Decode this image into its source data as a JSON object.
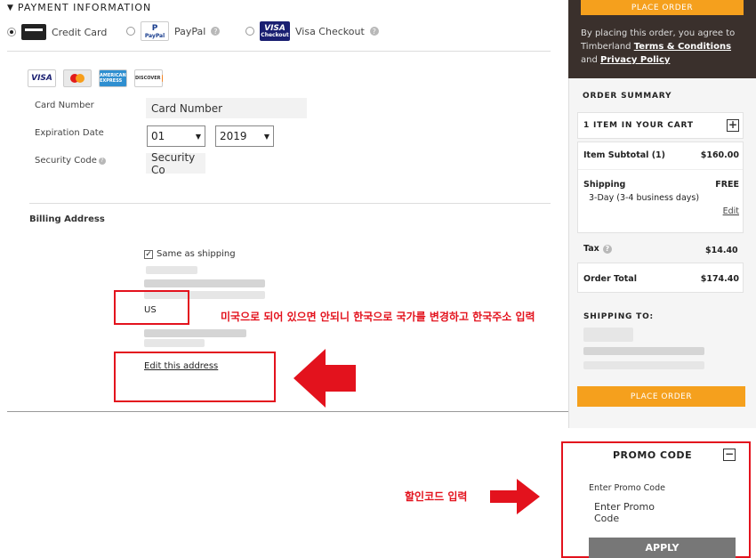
{
  "payment": {
    "header": "PAYMENT INFORMATION",
    "methods": {
      "credit_card": "Credit Card",
      "paypal": "PayPal",
      "paypal_logo": "PayPal",
      "visa_checkout": "Visa Checkout",
      "visa_logo_top": "VISA",
      "visa_logo_bottom": "Checkout"
    },
    "card_logos": {
      "visa": "VISA",
      "amex": "AMERICAN EXPRESS",
      "discover": "DISCOVER"
    },
    "card_number_label": "Card Number",
    "card_number_placeholder": "Card Number",
    "expiration_label": "Expiration Date",
    "exp_month": "01",
    "exp_year": "2019",
    "security_label": "Security Code",
    "security_placeholder": "Security Co"
  },
  "billing": {
    "title": "Billing Address",
    "same_as_shipping": "Same as shipping",
    "country": "US",
    "edit_link": "Edit this address"
  },
  "annotations": {
    "address_note": "미국으로 되어 있으면 안되니 한국으로 국가를 변경하고 한국주소 입력",
    "promo_note": "할인코드 입력"
  },
  "summary": {
    "place_order": "PLACE ORDER",
    "agree_prefix": "By placing this order, you agree to Timberland ",
    "terms": "Terms & Conditions",
    "and": " and ",
    "privacy": "Privacy Policy",
    "title": "ORDER SUMMARY",
    "cart_label": "1 ITEM IN YOUR CART",
    "subtotal_label": "Item Subtotal (1)",
    "subtotal_value": "$160.00",
    "shipping_label": "Shipping",
    "shipping_value": "FREE",
    "shipping_method": "3-Day  (3-4 business days)",
    "edit": "Edit",
    "tax_label": "Tax",
    "tax_value": "$14.40",
    "total_label": "Order Total",
    "total_value": "$174.40",
    "shipping_to": "SHIPPING TO:"
  },
  "promo": {
    "title": "PROMO CODE",
    "label": "Enter Promo Code",
    "placeholder": "Enter Promo Code",
    "apply": "APPLY"
  },
  "colors": {
    "accent_orange": "#f5a01d",
    "dark_brown": "#3a302c",
    "annotation_red": "#e3121d"
  }
}
